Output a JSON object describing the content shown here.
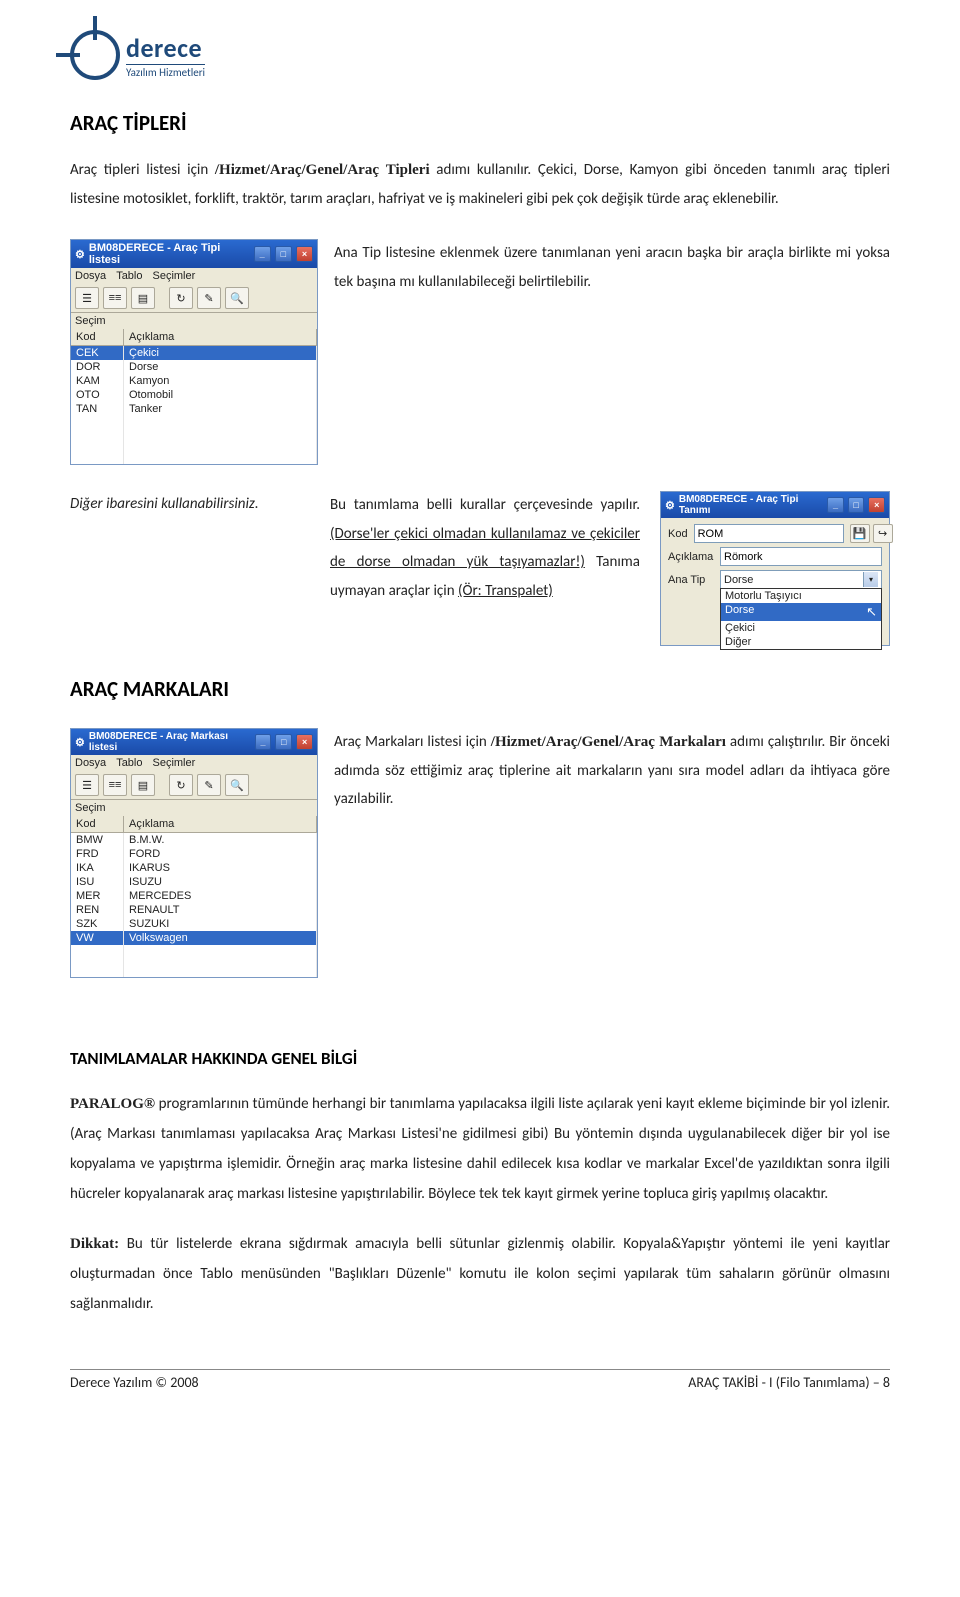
{
  "logo": {
    "brand": "derece",
    "tagline": "Yazılım Hizmetleri"
  },
  "section1": {
    "heading": "ARAÇ TİPLERİ",
    "intro_prefix": "Araç tipleri listesi için ",
    "intro_path": "/Hizmet/Araç/Genel/Araç Tipleri",
    "intro_suffix": " adımı kullanılır. Çekici, Dorse, Kamyon gibi önceden tanımlı araç tipleri listesine motosiklet, forklift, traktör, tarım araçları, hafriyat ve iş makineleri gibi pek çok değişik türde araç eklenebilir.",
    "para2": "Ana Tip listesine eklenmek üzere tanımlanan yeni aracın başka bir araçla birlikte mi yoksa tek başına mı kullanılabileceği belirtilebilir.",
    "para3a": "Bu tanımlama belli kurallar çerçevesinde yapılır. ",
    "para3b": "(Dorse'ler çekici olmadan kullanılamaz ve çekiciler de dorse olmadan yük taşıyamazlar!)",
    "para3c": " Tanıma uymayan araçlar için ",
    "para3d": "(Ör: Transpalet)",
    "caption": "Diğer ibaresini kullanabilirsiniz."
  },
  "win1": {
    "title": "BM08DERECE - Araç Tipi listesi",
    "menu": {
      "m1": "Dosya",
      "m2": "Tablo",
      "m3": "Seçimler"
    },
    "section": "Seçim",
    "cols": {
      "c1": "Kod",
      "c2": "Açıklama"
    },
    "rows": [
      {
        "k": "CEK",
        "a": "Çekici",
        "sel": true
      },
      {
        "k": "DOR",
        "a": "Dorse"
      },
      {
        "k": "KAM",
        "a": "Kamyon"
      },
      {
        "k": "OTO",
        "a": "Otomobil"
      },
      {
        "k": "TAN",
        "a": "Tanker"
      }
    ]
  },
  "win2": {
    "title": "BM08DERECE - Araç Tipi Tanımı",
    "f1": {
      "label": "Kod",
      "val": "ROM"
    },
    "f2": {
      "label": "Açıklama",
      "val": "Römork"
    },
    "f3": {
      "label": "Ana Tip",
      "val": "Dorse"
    },
    "opts": [
      "Motorlu Taşıyıcı",
      "Dorse",
      "Çekici",
      "Diğer"
    ]
  },
  "section2": {
    "heading": "ARAÇ MARKALARI",
    "para_prefix": "Araç Markaları listesi için ",
    "para_path": "/Hizmet/Araç/Genel/Araç Markaları",
    "para_suffix": " adımı çalıştırılır. Bir önceki adımda söz ettiğimiz araç tiplerine ait markaların yanı sıra model adları da ihtiyaca göre yazılabilir."
  },
  "win3": {
    "title": "BM08DERECE - Araç Markası listesi",
    "menu": {
      "m1": "Dosya",
      "m2": "Tablo",
      "m3": "Seçimler"
    },
    "section": "Seçim",
    "cols": {
      "c1": "Kod",
      "c2": "Açıklama"
    },
    "rows": [
      {
        "k": "BMW",
        "a": "B.M.W."
      },
      {
        "k": "FRD",
        "a": "FORD"
      },
      {
        "k": "IKA",
        "a": "IKARUS"
      },
      {
        "k": "ISU",
        "a": "ISUZU"
      },
      {
        "k": "MER",
        "a": "MERCEDES"
      },
      {
        "k": "REN",
        "a": "RENAULT"
      },
      {
        "k": "SZK",
        "a": "SUZUKI"
      },
      {
        "k": "VW",
        "a": "Volkswagen",
        "sel": true
      }
    ]
  },
  "section3": {
    "heading": "TANIMLAMALAR HAKKINDA GENEL BİLGİ",
    "brand": "PARALOG®",
    "para1": " programlarının tümünde herhangi bir tanımlama yapılacaksa ilgili liste açılarak yeni kayıt ekleme biçiminde bir yol izlenir. (Araç Markası tanımlaması yapılacaksa Araç Markası Listesi'ne gidilmesi gibi) Bu yöntemin dışında uygulanabilecek diğer bir yol ise kopyalama ve yapıştırma işlemidir. Örneğin araç marka listesine dahil edilecek kısa kodlar ve markalar Excel'de yazıldıktan sonra ilgili hücreler kopyalanarak araç markası listesine yapıştırılabilir. Böylece tek tek kayıt girmek yerine topluca giriş yapılmış olacaktır.",
    "dikkat_label": "Dikkat:",
    "para2": " Bu tür listelerde ekrana sığdırmak amacıyla belli sütunlar gizlenmiş olabilir. Kopyala&Yapıştır yöntemi ile yeni kayıtlar oluşturmadan önce Tablo menüsünden \"Başlıkları Düzenle\" komutu ile kolon seçimi yapılarak tüm sahaların görünür olmasını sağlanmalıdır."
  },
  "footer": {
    "left": "Derece Yazılım © 2008",
    "right": "ARAÇ TAKİBİ - I (Filo Tanımlama) – 8"
  }
}
